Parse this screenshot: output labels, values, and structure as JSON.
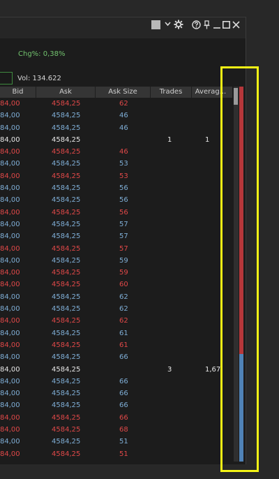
{
  "toolbar": {
    "icons": [
      "color-swatch-icon",
      "chevron-down-icon",
      "gear-icon",
      "help-icon",
      "pin-icon",
      "minimize-icon",
      "maximize-icon",
      "close-icon"
    ]
  },
  "info": {
    "chg": "Chg%: 0,38%",
    "vol": "Vol: 134.622"
  },
  "columns": [
    "Bid",
    "Ask",
    "Ask Size",
    "Trades",
    "Averag..."
  ],
  "rows": [
    {
      "bid": "84,00",
      "ask": "4584,25",
      "size": "62",
      "trades": "",
      "avg": "",
      "color": "red"
    },
    {
      "bid": "84,00",
      "ask": "4584,25",
      "size": "46",
      "trades": "",
      "avg": "",
      "color": "blue"
    },
    {
      "bid": "84,00",
      "ask": "4584,25",
      "size": "46",
      "trades": "",
      "avg": "",
      "color": "blue"
    },
    {
      "bid": "84,00",
      "ask": "4584,25",
      "size": "",
      "trades": "1",
      "avg": "1",
      "color": "white"
    },
    {
      "bid": "84,00",
      "ask": "4584,25",
      "size": "46",
      "trades": "",
      "avg": "",
      "color": "red"
    },
    {
      "bid": "84,00",
      "ask": "4584,25",
      "size": "53",
      "trades": "",
      "avg": "",
      "color": "blue"
    },
    {
      "bid": "84,00",
      "ask": "4584,25",
      "size": "53",
      "trades": "",
      "avg": "",
      "color": "red"
    },
    {
      "bid": "84,00",
      "ask": "4584,25",
      "size": "56",
      "trades": "",
      "avg": "",
      "color": "blue"
    },
    {
      "bid": "84,00",
      "ask": "4584,25",
      "size": "56",
      "trades": "",
      "avg": "",
      "color": "blue"
    },
    {
      "bid": "84,00",
      "ask": "4584,25",
      "size": "56",
      "trades": "",
      "avg": "",
      "color": "red"
    },
    {
      "bid": "84,00",
      "ask": "4584,25",
      "size": "57",
      "trades": "",
      "avg": "",
      "color": "blue"
    },
    {
      "bid": "84,00",
      "ask": "4584,25",
      "size": "57",
      "trades": "",
      "avg": "",
      "color": "blue"
    },
    {
      "bid": "84,00",
      "ask": "4584,25",
      "size": "57",
      "trades": "",
      "avg": "",
      "color": "red"
    },
    {
      "bid": "84,00",
      "ask": "4584,25",
      "size": "59",
      "trades": "",
      "avg": "",
      "color": "blue"
    },
    {
      "bid": "84,00",
      "ask": "4584,25",
      "size": "59",
      "trades": "",
      "avg": "",
      "color": "red"
    },
    {
      "bid": "84,00",
      "ask": "4584,25",
      "size": "60",
      "trades": "",
      "avg": "",
      "color": "red"
    },
    {
      "bid": "84,00",
      "ask": "4584,25",
      "size": "62",
      "trades": "",
      "avg": "",
      "color": "blue"
    },
    {
      "bid": "84,00",
      "ask": "4584,25",
      "size": "62",
      "trades": "",
      "avg": "",
      "color": "blue"
    },
    {
      "bid": "84,00",
      "ask": "4584,25",
      "size": "62",
      "trades": "",
      "avg": "",
      "color": "red"
    },
    {
      "bid": "84,00",
      "ask": "4584,25",
      "size": "61",
      "trades": "",
      "avg": "",
      "color": "blue"
    },
    {
      "bid": "84,00",
      "ask": "4584,25",
      "size": "61",
      "trades": "",
      "avg": "",
      "color": "red"
    },
    {
      "bid": "84,00",
      "ask": "4584,25",
      "size": "66",
      "trades": "",
      "avg": "",
      "color": "blue"
    },
    {
      "bid": "84,00",
      "ask": "4584,25",
      "size": "",
      "trades": "3",
      "avg": "1,67",
      "color": "white"
    },
    {
      "bid": "84,00",
      "ask": "4584,25",
      "size": "66",
      "trades": "",
      "avg": "",
      "color": "blue"
    },
    {
      "bid": "84,00",
      "ask": "4584,25",
      "size": "66",
      "trades": "",
      "avg": "",
      "color": "blue"
    },
    {
      "bid": "84,00",
      "ask": "4584,25",
      "size": "66",
      "trades": "",
      "avg": "",
      "color": "blue"
    },
    {
      "bid": "84,00",
      "ask": "4584,25",
      "size": "66",
      "trades": "",
      "avg": "",
      "color": "red"
    },
    {
      "bid": "84,00",
      "ask": "4584,25",
      "size": "68",
      "trades": "",
      "avg": "",
      "color": "red"
    },
    {
      "bid": "84,00",
      "ask": "4584,25",
      "size": "51",
      "trades": "",
      "avg": "",
      "color": "blue"
    },
    {
      "bid": "84,00",
      "ask": "4584,25",
      "size": "51",
      "trades": "",
      "avg": "",
      "color": "red"
    }
  ],
  "colors": {
    "red": "#e04848",
    "blue": "#7faed6",
    "white": "#e8e8e8",
    "highlight": "#f3f315",
    "heat_red": "#b5373a",
    "heat_blue": "#4f82b6"
  }
}
